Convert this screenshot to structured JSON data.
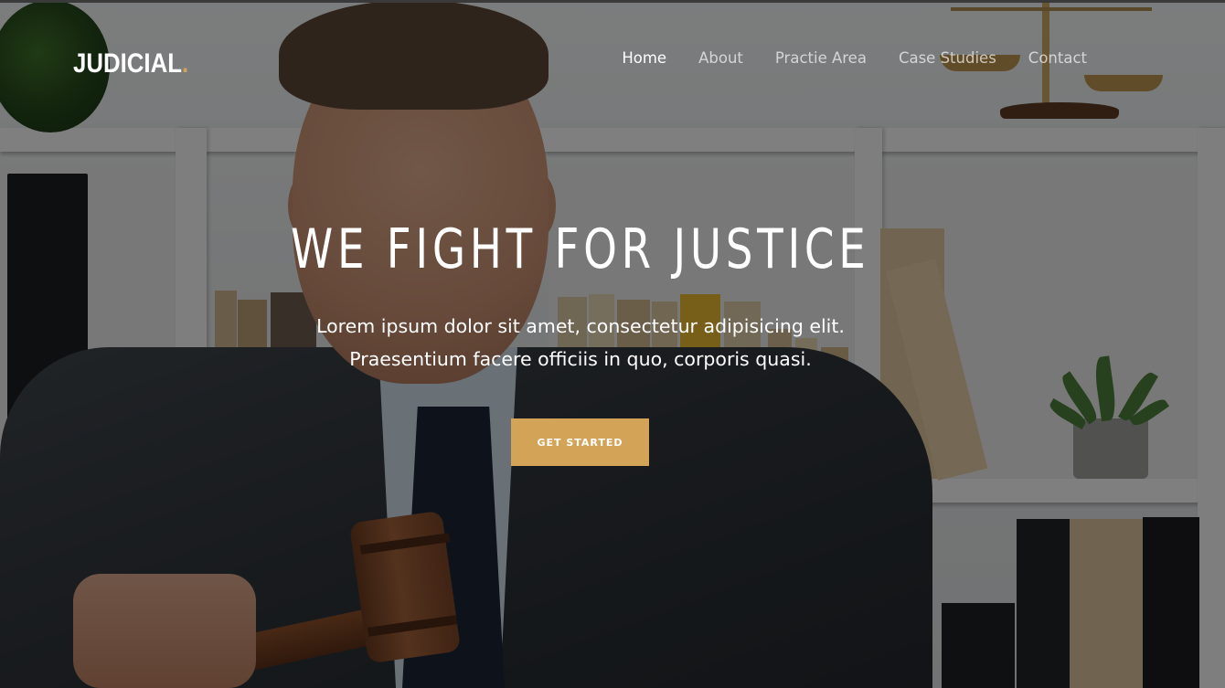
{
  "brand": {
    "name": "JUDICIAL",
    "dot": ".",
    "accent": "#d3a458"
  },
  "nav": {
    "items": [
      {
        "label": "Home",
        "active": true
      },
      {
        "label": "About",
        "active": false
      },
      {
        "label": "Practie Area",
        "active": false
      },
      {
        "label": "Case Studies",
        "active": false
      },
      {
        "label": "Contact",
        "active": false
      }
    ]
  },
  "hero": {
    "title": "WE FIGHT FOR JUSTICE",
    "subtitle_line1": "Lorem ipsum dolor sit amet, consectetur adipisicing elit.",
    "subtitle_line2": "Praesentium facere officiis in quo, corporis quasi.",
    "cta_label": "GET STARTED",
    "cta_color": "#d3a458"
  }
}
